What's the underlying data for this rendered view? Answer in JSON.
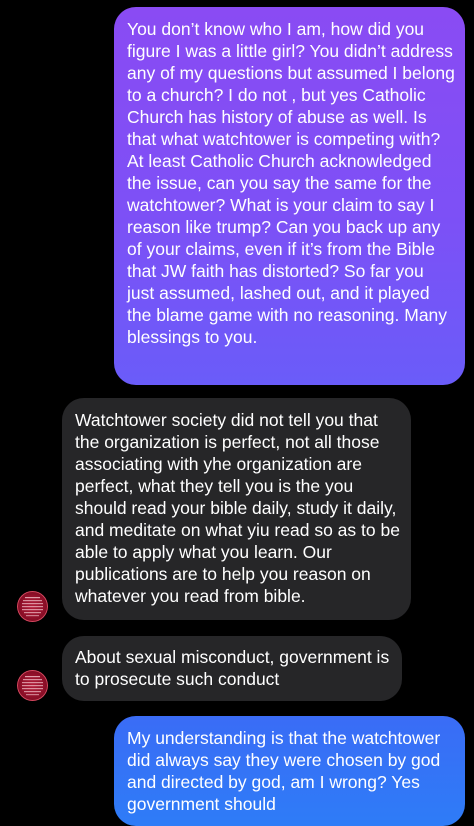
{
  "messages": [
    {
      "direction": "sent",
      "text": "You don’t know who I am, how did you figure I was a little girl? You didn’t address any of my questions but assumed I belong to a church? I do not , but yes Catholic Church has history of abuse as well. Is that what watchtower is competing with? At least Catholic Church acknowledged the issue, can you say the same for the watchtower? What is your claim to say I reason like trump? Can you back up any of your claims, even if it’s from the Bible that JW faith has distorted? So far you just assumed, lashed out, and it played the blame game with no reasoning. Many blessings to you."
    },
    {
      "direction": "received",
      "text": "Watchtower society did not tell you that the organization is perfect, not all those associating with yhe organization are perfect, what they tell you is the you should read your bible daily, study it daily, and meditate on what yiu read so as to be able to apply what you learn. Our publications are to help you reason on whatever you read from bible."
    },
    {
      "direction": "received",
      "text": "About sexual misconduct, government is to prosecute such conduct"
    },
    {
      "direction": "sent",
      "text": "My understanding is that the watchtower did always say they were chosen by god and directed by god, am I wrong? Yes government should"
    }
  ],
  "colors": {
    "background": "#000000",
    "sent_gradient_top": "#8a4bf3",
    "sent_gradient_bottom": "#6a5cf9",
    "sent_blue": "#2e7cf7",
    "received_bubble": "#262628",
    "text": "#ffffff",
    "avatar": "#a3162f"
  },
  "icons": {
    "contact_avatar": "profile-picture-icon"
  }
}
